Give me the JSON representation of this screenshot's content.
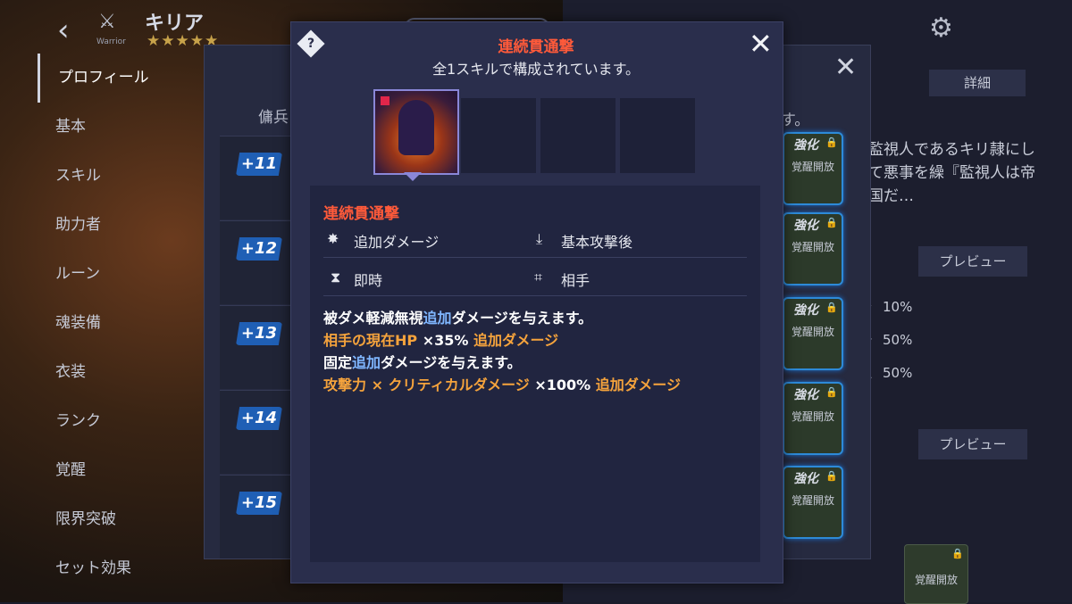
{
  "hero": {
    "name": "キリア",
    "class_label": "Warrior",
    "stars": "★★★★★"
  },
  "sidebar": {
    "items": [
      {
        "label": "プロフィール"
      },
      {
        "label": "基本"
      },
      {
        "label": "スキル"
      },
      {
        "label": "助力者"
      },
      {
        "label": "ルーン"
      },
      {
        "label": "魂装備"
      },
      {
        "label": "衣装"
      },
      {
        "label": "ランク"
      },
      {
        "label": "覚醒"
      },
      {
        "label": "限界突破"
      },
      {
        "label": "セット効果"
      }
    ]
  },
  "under_panel": {
    "col_left": "傭兵",
    "col_right": "す。",
    "levels": [
      "+11",
      "+12",
      "+13",
      "+14",
      "+15"
    ],
    "upgrade_cards": [
      {
        "top": "強化",
        "label": "覚醒開放"
      },
      {
        "top": "強化",
        "label": "覚醒開放"
      },
      {
        "top": "強化",
        "label": "覚醒開放"
      },
      {
        "top": "強化",
        "label": "覚醒開放"
      },
      {
        "top": "強化",
        "label": "覚醒開放"
      }
    ]
  },
  "right_panel": {
    "detail_tab": "詳細",
    "description": "監視人であるキリ隷にして悪事を繰『監視人は帝国だ…",
    "preview_label_1": "プレビュー",
    "preview_label_2": "プレビュー",
    "stats": [
      "10%",
      "50%",
      "50%"
    ],
    "awaken_card_label": "覚醒開放"
  },
  "modal": {
    "title": "連続貫通撃",
    "subtitle": "全1スキルで構成されています。",
    "skill_name": "連続貫通撃",
    "attributes": {
      "type": "追加ダメージ",
      "trigger": "基本攻撃後",
      "timing": "即時",
      "target": "相手"
    },
    "desc": {
      "line1_a": "被ダメ軽減無視",
      "line1_b": "追加",
      "line1_c": "ダメージを与えます。",
      "line2_a": "相手の現在HP",
      "line2_b": " ×35% ",
      "line2_c": "追加ダメージ",
      "line3_a": "固定",
      "line3_b": "追加",
      "line3_c": "ダメージを与えます。",
      "line4_a": "攻撃力 × クリティカルダメージ",
      "line4_b": " ×100% ",
      "line4_c": "追加ダメージ"
    }
  },
  "colors": {
    "accent_red": "#ff5a3a",
    "accent_blue": "#7fb6ff",
    "accent_orange": "#f5a33c"
  }
}
